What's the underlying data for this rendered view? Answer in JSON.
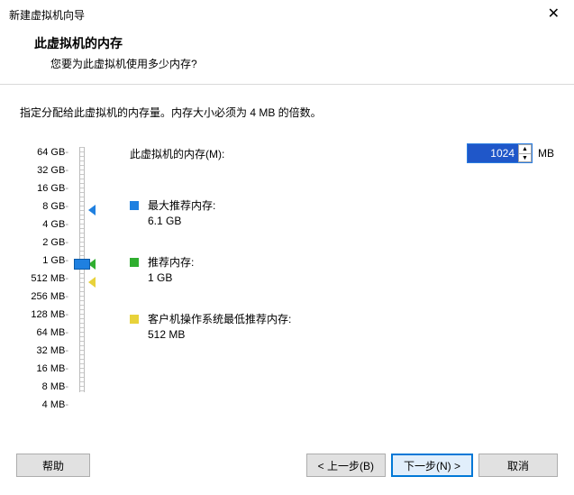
{
  "window": {
    "title": "新建虚拟机向导"
  },
  "header": {
    "title": "此虚拟机的内存",
    "subtitle": "您要为此虚拟机使用多少内存?"
  },
  "description": "指定分配给此虚拟机的内存量。内存大小必须为 4 MB 的倍数。",
  "memory": {
    "label": "此虚拟机的内存(M):",
    "value": "1024",
    "unit": "MB"
  },
  "scale": [
    "64 GB",
    "32 GB",
    "16 GB",
    "8 GB",
    "4 GB",
    "2 GB",
    "1 GB",
    "512 MB",
    "256 MB",
    "128 MB",
    "64 MB",
    "32 MB",
    "16 MB",
    "8 MB",
    "4 MB"
  ],
  "markers": {
    "max": {
      "tick_index": 3,
      "color": "blue"
    },
    "rec": {
      "tick_index": 6,
      "color": "green"
    },
    "min": {
      "tick_index": 7,
      "color": "yellow"
    },
    "slider": {
      "tick_index": 6
    }
  },
  "recommendations": {
    "max": {
      "label": "最大推荐内存:",
      "value": "6.1 GB"
    },
    "rec": {
      "label": "推荐内存:",
      "value": "1 GB"
    },
    "min": {
      "label": "客户机操作系统最低推荐内存:",
      "value": "512 MB"
    }
  },
  "buttons": {
    "help": "帮助",
    "back": "< 上一步(B)",
    "next": "下一步(N) >",
    "cancel": "取消"
  }
}
